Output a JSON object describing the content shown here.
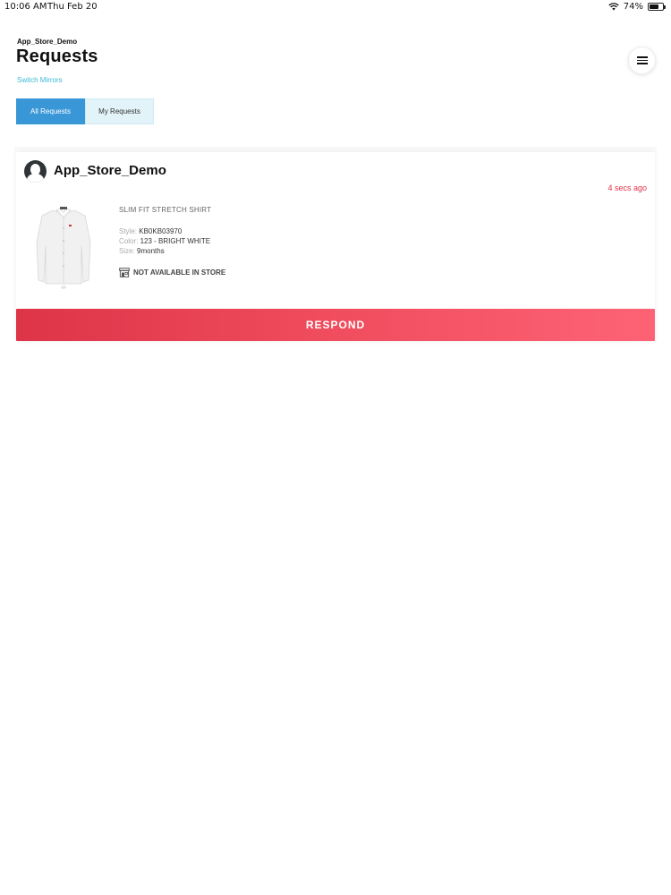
{
  "status_bar": {
    "time": "10:06 AM",
    "date": "Thu Feb 20",
    "battery": "74%",
    "battery_level": 0.74
  },
  "header": {
    "store_name": "App_Store_Demo",
    "title": "Requests",
    "switch_link": "Switch Mirrors",
    "menu_icon": "hamburger-menu-icon"
  },
  "tabs": [
    {
      "label": "All Requests",
      "active": true
    },
    {
      "label": "My Requests",
      "active": false
    }
  ],
  "request": {
    "store": "App_Store_Demo",
    "time_ago": "4 secs ago",
    "product": {
      "name": "SLIM FIT STRETCH SHIRT",
      "style_label": "Style:",
      "style": "KB0KB03970",
      "color_label": "Color:",
      "color": "123 - BRIGHT WHITE",
      "size_label": "Size:",
      "size": "9months"
    },
    "availability": "NOT AVAILABLE IN STORE",
    "respond_label": "RESPOND"
  },
  "colors": {
    "accent_blue": "#3a97d7",
    "link_cyan": "#3bb8d6",
    "time_red": "#e0304a",
    "respond_gradient_start": "#de3448",
    "respond_gradient_end": "#fd6375"
  }
}
